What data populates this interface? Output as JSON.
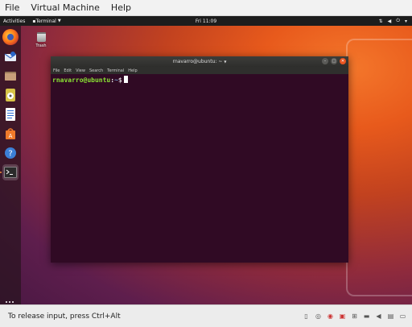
{
  "host_menubar": {
    "items": [
      "File",
      "Virtual Machine",
      "Help"
    ]
  },
  "guest": {
    "topbar": {
      "activities": "Activities",
      "app_menu": "Terminal",
      "clock": "Fri 11:09"
    },
    "desktop": {
      "trash_label": "Trash"
    },
    "dock": {
      "items": [
        "firefox-icon",
        "thunderbird-icon",
        "files-icon",
        "rhythmbox-icon",
        "libreoffice-writer-icon",
        "software-center-icon",
        "help-icon",
        "terminal-icon"
      ],
      "active": "terminal-icon"
    },
    "terminal": {
      "title": "rnavarro@ubuntu: ~",
      "menu": [
        "File",
        "Edit",
        "View",
        "Search",
        "Terminal",
        "Help"
      ],
      "prompt_user": "rnavarro@ubuntu",
      "prompt_sep": ":",
      "prompt_path": "~",
      "prompt_symbol": "$"
    }
  },
  "statusbar": {
    "message": "To release input, press Ctrl+Alt"
  },
  "colors": {
    "terminal_bg": "#300a24",
    "ubuntu_orange": "#e95420",
    "prompt_green": "#8ae234",
    "prompt_blue": "#729fcf"
  }
}
